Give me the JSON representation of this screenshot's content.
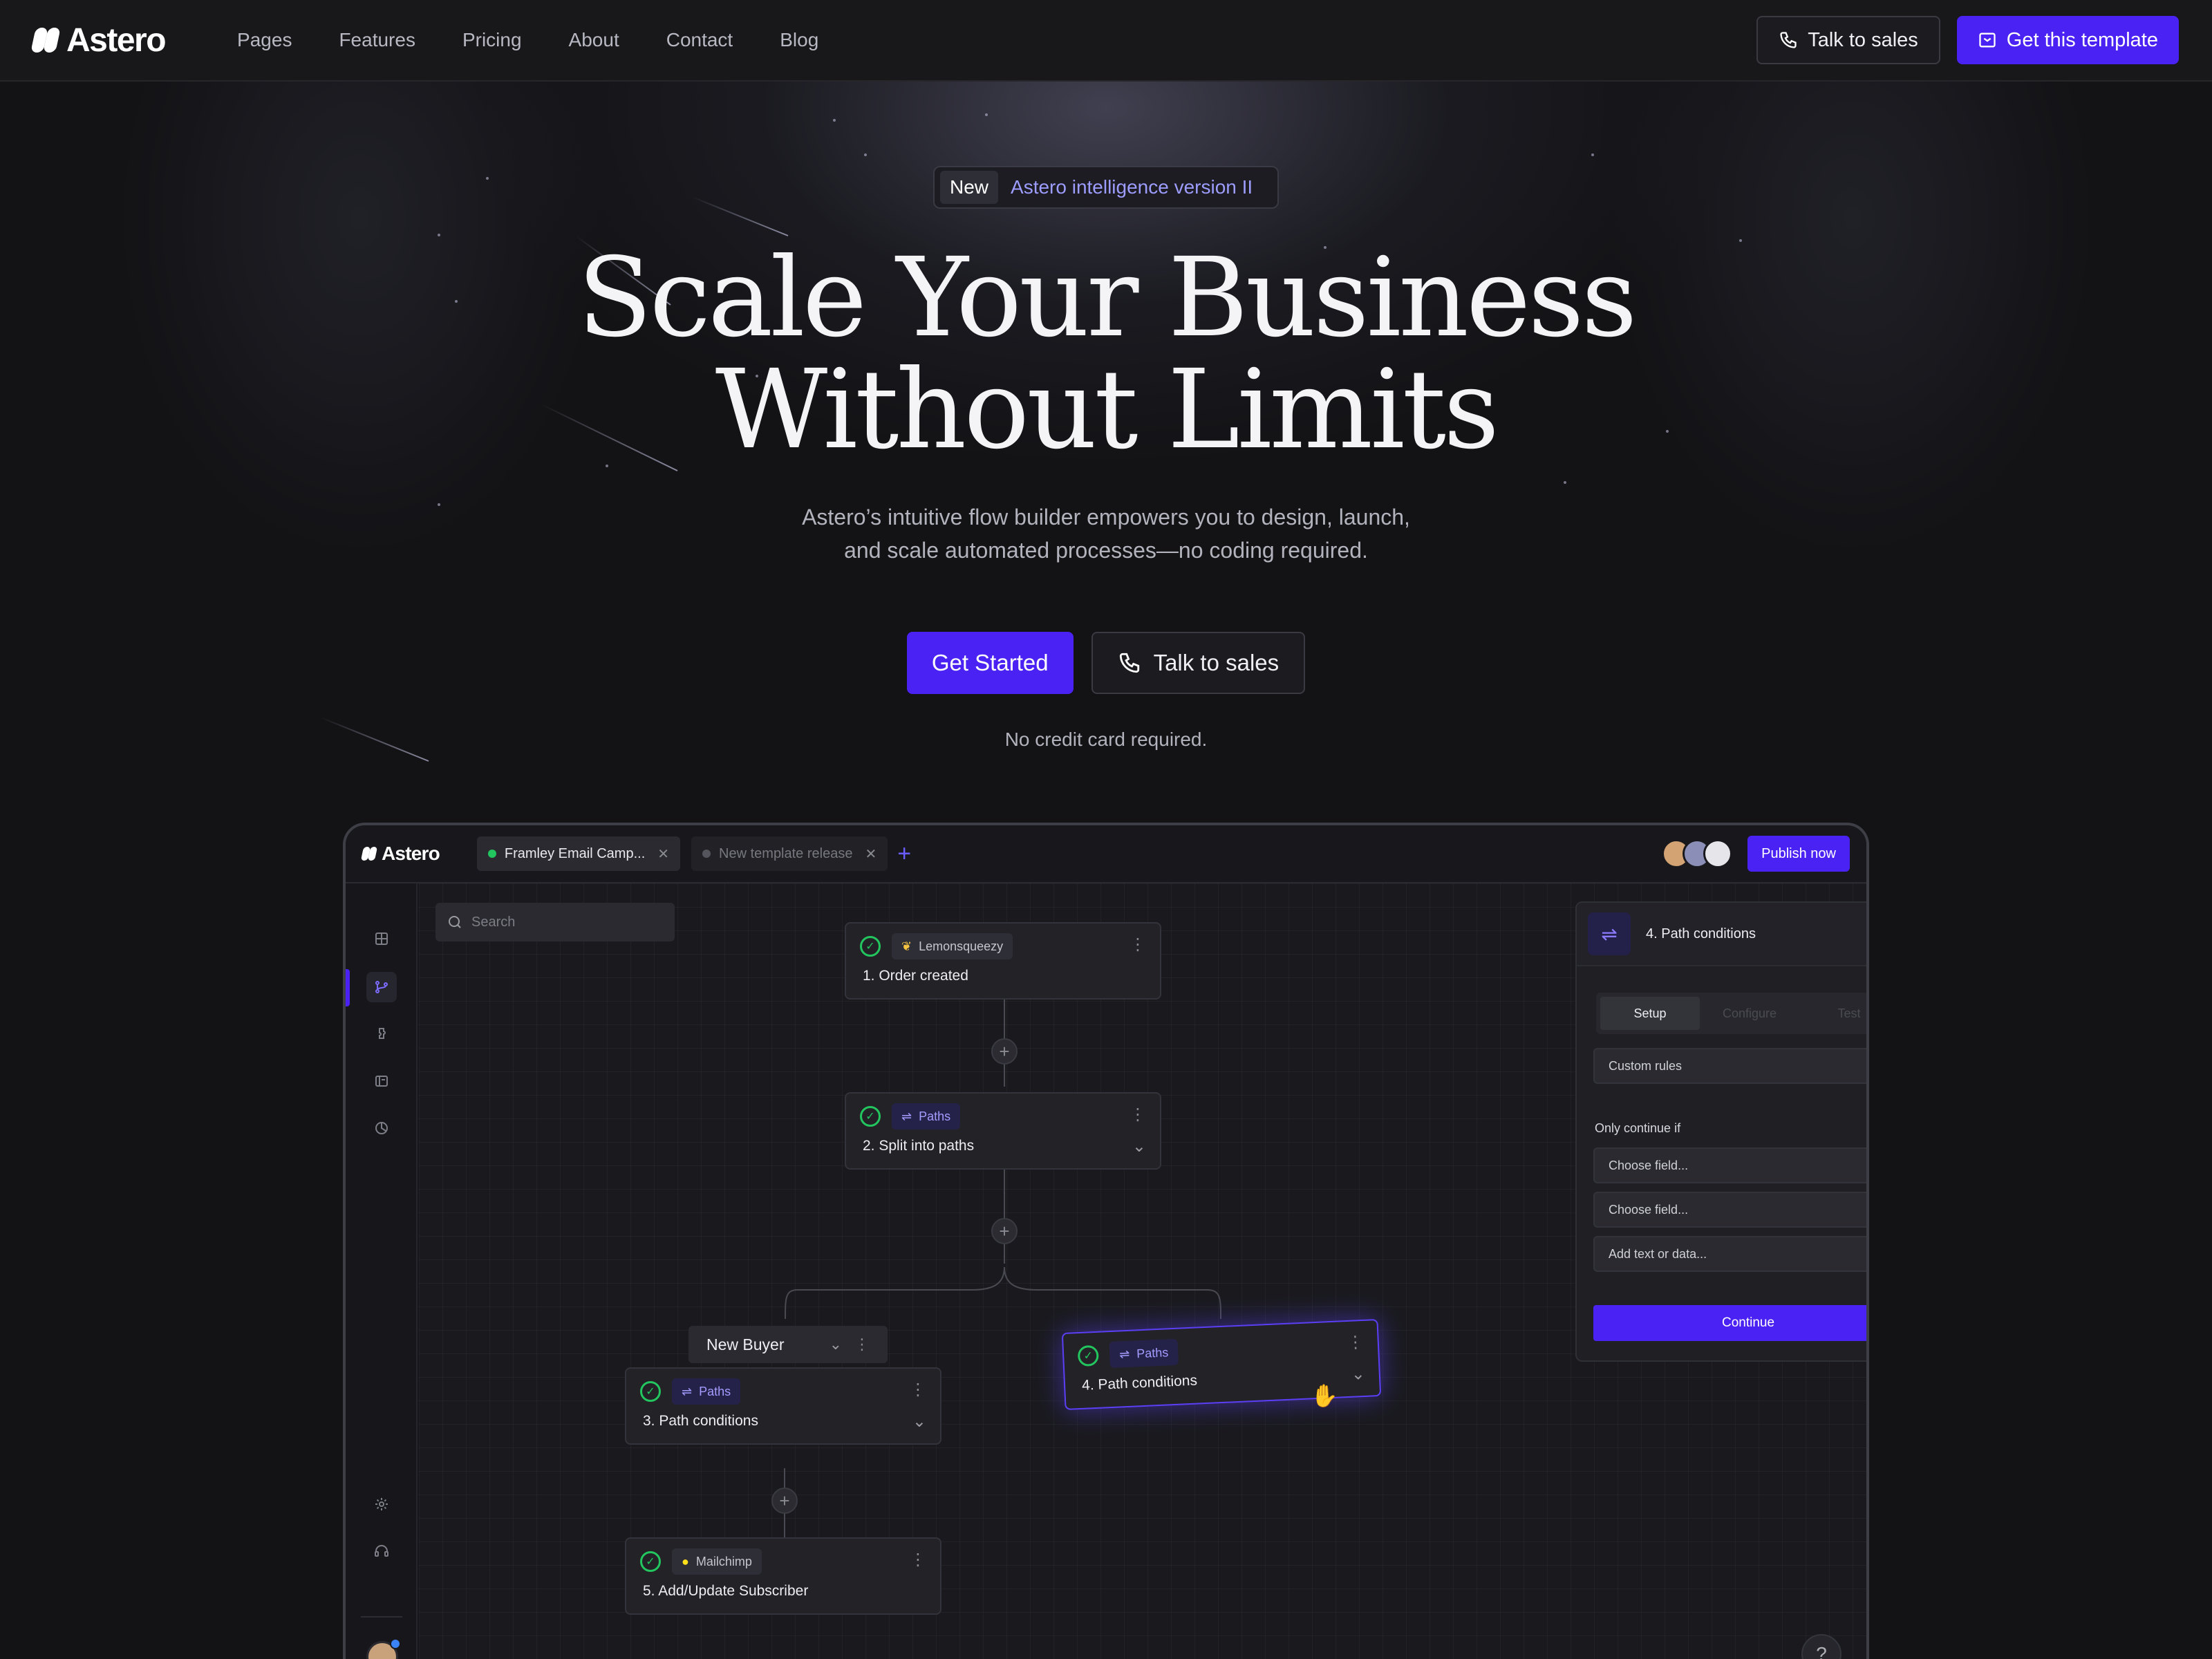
{
  "brand": {
    "name": "Astero",
    "accent": "#4b22f4"
  },
  "nav": {
    "links": [
      "Pages",
      "Features",
      "Pricing",
      "About",
      "Contact",
      "Blog"
    ],
    "talk_sales": "Talk to sales",
    "get_template": "Get this template"
  },
  "hero": {
    "badge_new": "New",
    "badge_text": "Astero intelligence version II",
    "headline_1": "Scale Your Business",
    "headline_2": "Without Limits",
    "sub_1": "Astero’s intuitive flow builder empowers you to design, launch,",
    "sub_2": "and scale automated processes—no coding required.",
    "cta_primary": "Get Started",
    "cta_secondary": "Talk to sales",
    "note": "No credit card required."
  },
  "app": {
    "logo": "Astero",
    "tabs": [
      {
        "label": "Framley Email Camp...",
        "status_color": "#22c55e"
      },
      {
        "label": "New template release",
        "status_color": "#55555d"
      }
    ],
    "publish": "Publish now",
    "search_placeholder": "Search",
    "nodes": {
      "n1": {
        "app": "Lemonsqueezy",
        "title": "1. Order created"
      },
      "n2": {
        "app": "Paths",
        "title": "2. Split into paths"
      },
      "n3": {
        "app": "Paths",
        "title": "3. Path conditions"
      },
      "n4": {
        "app": "Paths",
        "title": "4. Path conditions"
      },
      "n5": {
        "app": "Mailchimp",
        "title": "5. Add/Update Subscriber"
      }
    },
    "branch_label": "New Buyer",
    "panel": {
      "title": "4. Path conditions",
      "tabs": [
        "Setup",
        "Configure",
        "Test"
      ],
      "rule_select": "Custom rules",
      "label": "Only continue if",
      "field_1": "Choose field...",
      "field_2": "Choose field...",
      "field_3": "Add text or data...",
      "continue": "Continue"
    },
    "help": "?"
  }
}
